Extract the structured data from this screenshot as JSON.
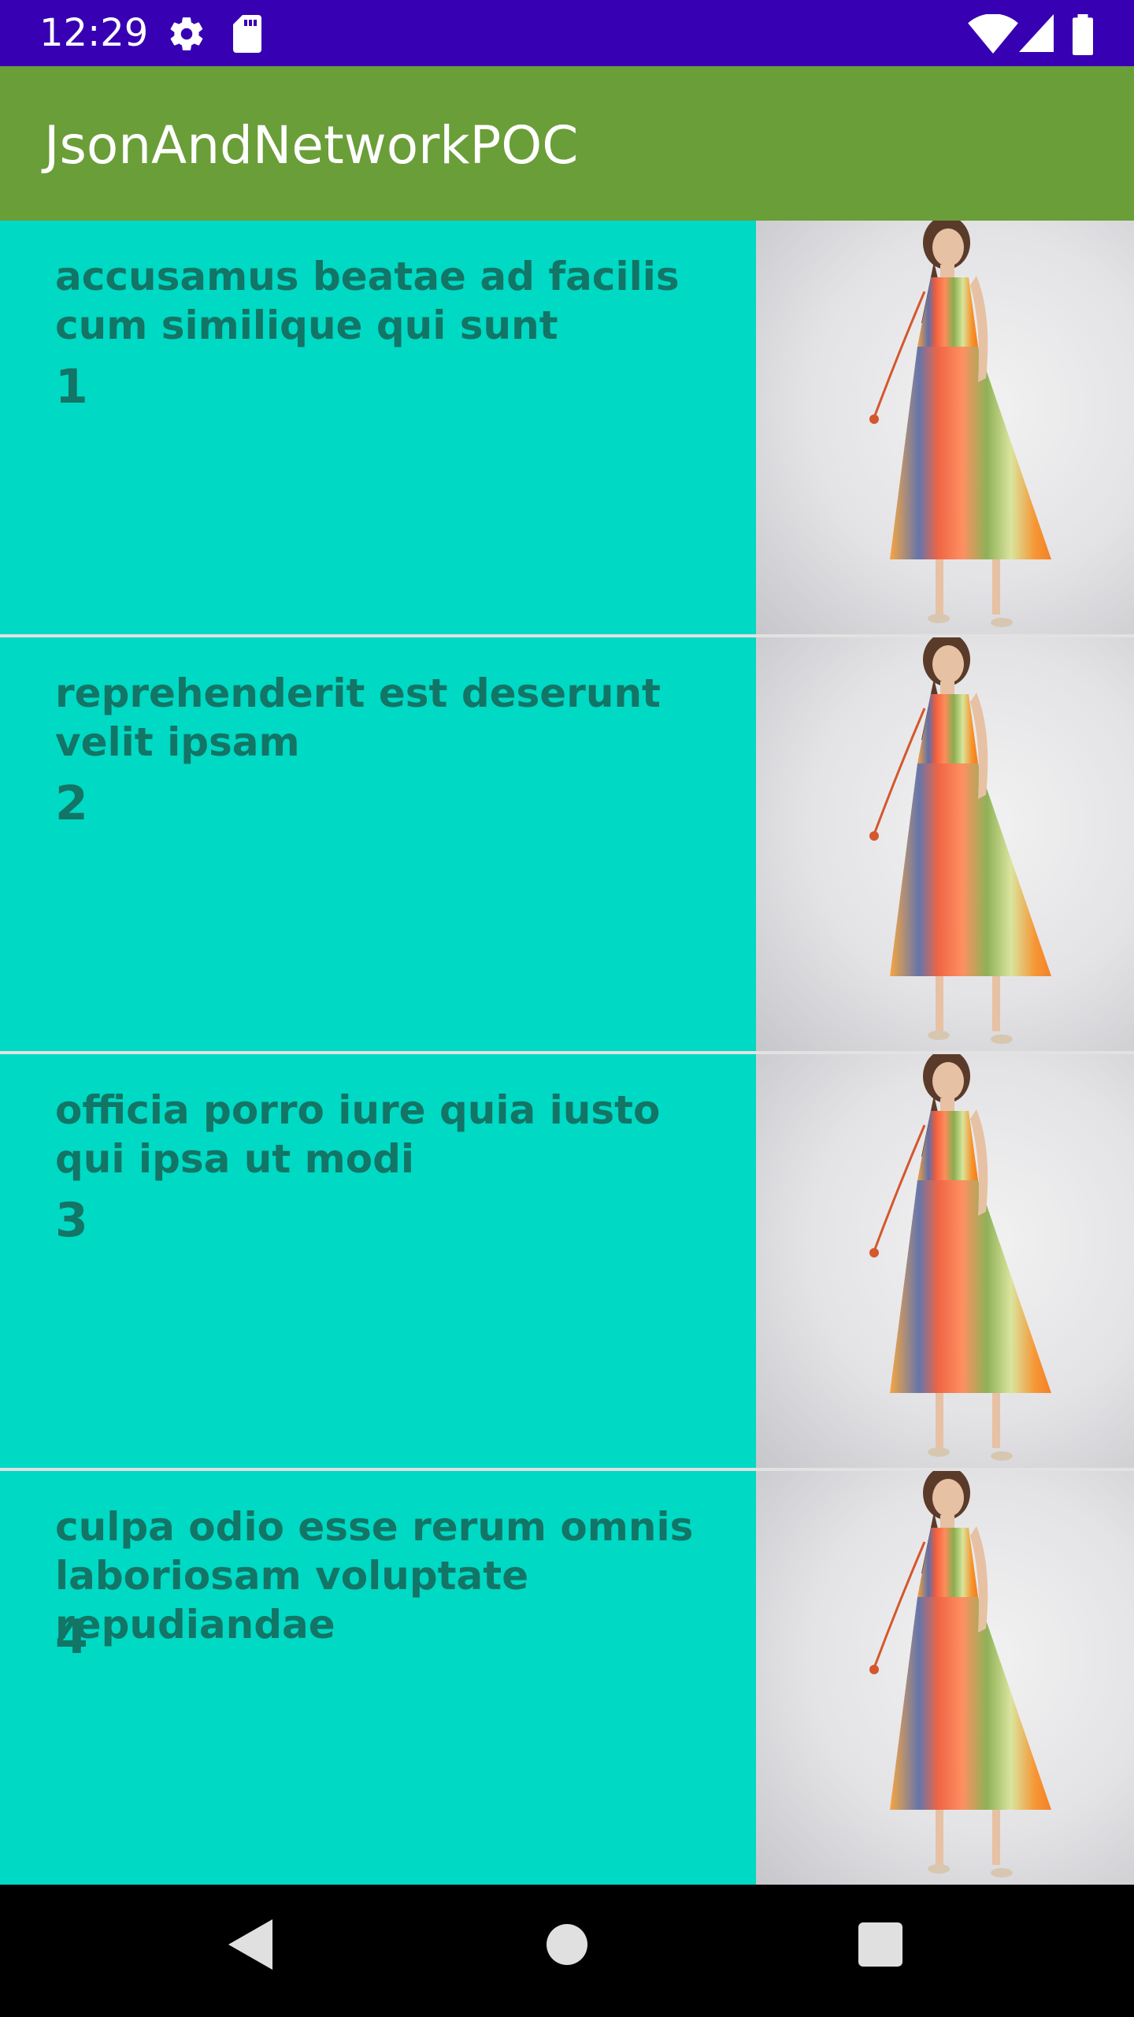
{
  "status_bar": {
    "time": "12:29",
    "icons": [
      "gear-icon",
      "sd-card-icon",
      "wifi-icon",
      "signal-icon",
      "battery-icon"
    ],
    "background": "#3700b3"
  },
  "app_bar": {
    "title": "JsonAndNetworkPOC",
    "background": "#6a9e38"
  },
  "list": {
    "item_background": "#00d9c4",
    "text_color": "#127566",
    "items": [
      {
        "title": "accusamus beatae ad facilis cum similique qui sunt",
        "id": "1",
        "image": "dress-photo"
      },
      {
        "title": "reprehenderit est deserunt velit ipsam",
        "id": "2",
        "image": "dress-photo"
      },
      {
        "title": "officia porro iure quia iusto qui ipsa ut modi",
        "id": "3",
        "image": "dress-photo"
      },
      {
        "title": "culpa odio esse rerum omnis laboriosam voluptate repudiandae",
        "id": "4",
        "image": "dress-photo"
      }
    ]
  },
  "nav_bar": {
    "buttons": [
      "back-icon",
      "home-icon",
      "recents-icon"
    ]
  }
}
